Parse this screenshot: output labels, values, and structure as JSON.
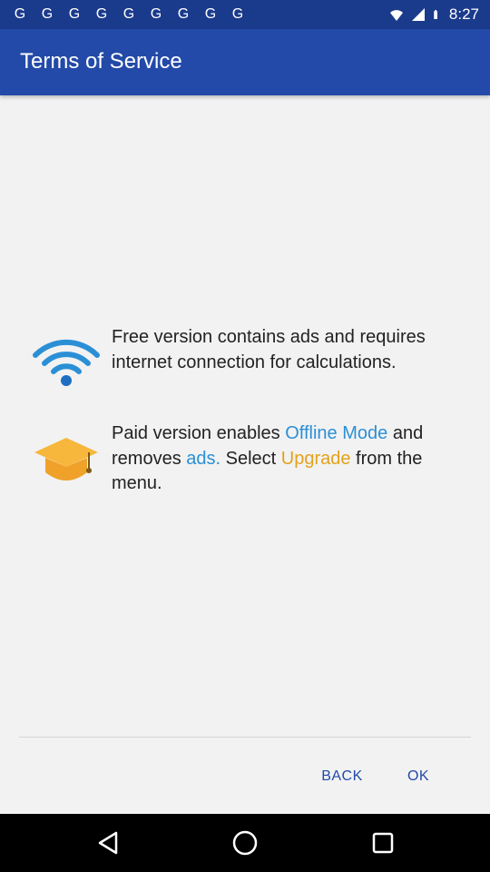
{
  "status_bar": {
    "time": "8:27",
    "left_icons": [
      "notification-g-icon",
      "notification-g-icon",
      "notification-g-icon",
      "notification-g-icon",
      "notification-g-icon",
      "notification-g-icon",
      "notification-g-icon",
      "notification-g-icon",
      "notification-g-icon"
    ],
    "right_icons": [
      "wifi-icon",
      "signal-icon",
      "battery-icon"
    ]
  },
  "app_bar": {
    "title": "Terms of Service"
  },
  "content": {
    "free": {
      "icon": "wifi-signal-icon",
      "text": "Free version contains ads and requires internet connection for calculations."
    },
    "paid": {
      "icon": "graduation-cap-icon",
      "text_1": "Paid version enables ",
      "highlight_offline": "Offline Mode",
      "text_2": " and removes ",
      "highlight_ads": "ads.",
      "text_3": " Select ",
      "highlight_upgrade": "Upgrade",
      "text_4": " from the menu."
    }
  },
  "buttons": {
    "back_label": "BACK",
    "ok_label": "OK"
  },
  "nav_bar": {
    "icons": [
      "back-triangle-icon",
      "home-circle-icon",
      "recents-square-icon"
    ]
  },
  "colors": {
    "status_bar": "#1a3a8c",
    "app_bar": "#234aa8",
    "highlight_blue": "#2b8fd6",
    "highlight_orange": "#e2a21d",
    "background": "#f2f2f2"
  }
}
